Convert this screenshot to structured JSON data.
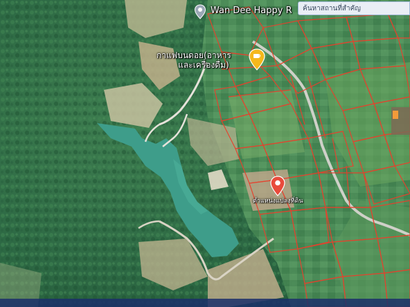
{
  "places": {
    "resort": {
      "name": "Wan Dee Happy R"
    },
    "cafe": {
      "name_line1": "กาแฟบนดอย(อาหาร",
      "name_line2": "และเครื่องดื่ม)"
    },
    "plot": {
      "name": "ตำแหน่งแปลงที่ดิน"
    }
  },
  "search": {
    "placeholder": "ค้นหาสถานที่สำคัญ"
  },
  "colors": {
    "forest": "#2f6b45",
    "lake": "#3e9d8a",
    "parcel_line": "#e8402c",
    "pin_red": "#e84b3c",
    "pin_yellow": "#f5b81c",
    "road": "#e6e2da"
  },
  "icons": {
    "resort": "location-pin-icon",
    "cafe": "cafe-pin-icon",
    "plot": "location-pin-icon"
  }
}
